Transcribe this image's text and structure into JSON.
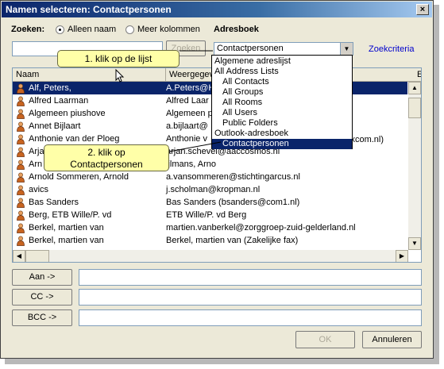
{
  "window": {
    "title": "Namen selecteren: Contactpersonen",
    "close_glyph": "×"
  },
  "search": {
    "label": "Zoeken:",
    "radio_name_only": "Alleen naam",
    "radio_more_columns": "Meer kolommen",
    "input_value": "",
    "button": "Zoeken",
    "advanced_link": "Zoekcriteria"
  },
  "address_book": {
    "label": "Adresboek",
    "selected": "Contactpersonen",
    "options": [
      "Algemene adreslijst",
      "All Address Lists",
      "All Contacts",
      "All Groups",
      "All Rooms",
      "All Users",
      "Public Folders",
      "Outlook-adresboek",
      "Contactpersonen"
    ],
    "highlighted_index": 8
  },
  "table": {
    "columns": [
      "Naam",
      "Weergegeven naam",
      "E-"
    ],
    "rows": [
      {
        "name": "Alf, Peters,",
        "display": "A.Peters@H",
        "selected": true
      },
      {
        "name": "Alfred Laarman",
        "display": "Alfred Laar"
      },
      {
        "name": "Algemeen piushove",
        "display": "Algemeen p"
      },
      {
        "name": "Annet Bijlaart",
        "display": "a.bijlaart@"
      },
      {
        "name": "Anthonie van der Ploeg",
        "display": "Anthonie v"
      },
      {
        "name": "Arja",
        "display": "arjan.schevel@aaccosmos.nl"
      },
      {
        "name": "Arn",
        "display": "ijlmans, Arno"
      },
      {
        "name": "Arnold Sommeren, Arnold",
        "display": "a.vansommeren@stichtingarcus.nl"
      },
      {
        "name": "avics",
        "display": "j.scholman@kropman.nl"
      },
      {
        "name": "Bas Sanders",
        "display": "Bas Sanders (bsanders@com1.nl)"
      },
      {
        "name": "Berg, ETB Wille/P. vd",
        "display": "ETB Wille/P. vd Berg"
      },
      {
        "name": "Berkel, martien van",
        "display": "martien.vanberkel@zorggroep-zuid-gelderland.nl"
      },
      {
        "name": "Berkel, martien van",
        "display": "Berkel, martien van (Zakelijke fax)"
      }
    ],
    "overflow_text": "@maxcom.nl)"
  },
  "recipients": {
    "to": "Aan ->",
    "cc": "CC ->",
    "bcc": "BCC ->"
  },
  "footer": {
    "ok": "OK",
    "cancel": "Annuleren"
  },
  "callouts": {
    "step1": "1. klik op de lijst",
    "step2_line1": "2. klik op",
    "step2_line2": "Contactpersonen"
  },
  "colors": {
    "title_start": "#0a246a",
    "selection": "#0a246a",
    "callout_bg": "#ffffa8",
    "link": "#0000cc"
  }
}
